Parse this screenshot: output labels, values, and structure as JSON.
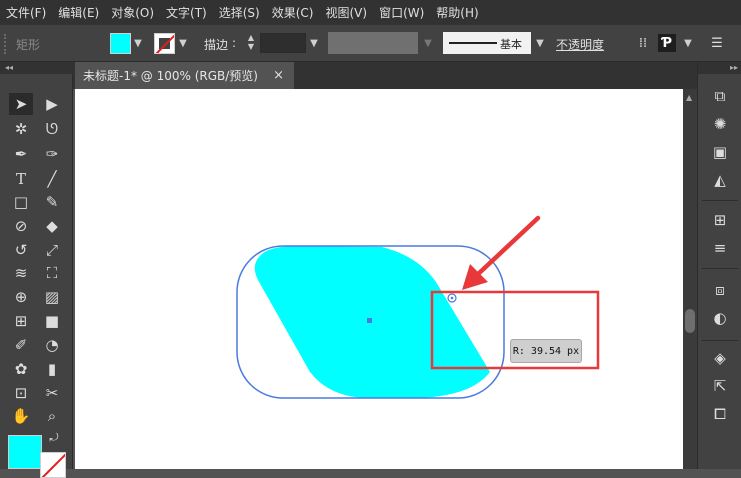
{
  "menu": [
    "文件(F)",
    "编辑(E)",
    "对象(O)",
    "文字(T)",
    "选择(S)",
    "效果(C)",
    "视图(V)",
    "窗口(W)",
    "帮助(H)"
  ],
  "control": {
    "tool_name": "矩形",
    "stroke_label": "描边",
    "stroke_colon": ":",
    "stroke_style": "基本",
    "opacity_label": "不透明度",
    "fill_color": "#00ffff",
    "stroke_color": "none"
  },
  "document": {
    "tab_title": "未标题-1* @ 100% (RGB/预览)",
    "close_glyph": "×"
  },
  "canvas": {
    "shape_fill": "#00ffff",
    "bounding_box_color": "#4a7ae0",
    "highlight_box_color": "#e8383a",
    "arrow_color": "#e8383a",
    "tooltip": "R: 39.54 px"
  },
  "left_tools": [
    "selection-tool",
    "direct-selection-tool",
    "magic-wand-tool",
    "lasso-tool",
    "pen-tool",
    "curvature-tool",
    "type-tool",
    "line-tool",
    "rectangle-tool",
    "paintbrush-tool",
    "shaper-tool",
    "eraser-tool",
    "rotate-tool",
    "scale-tool",
    "width-tool",
    "free-transform-tool",
    "shape-builder-tool",
    "perspective-grid-tool",
    "mesh-tool",
    "gradient-tool",
    "eyedropper-tool",
    "blend-tool",
    "symbol-sprayer-tool",
    "column-graph-tool",
    "artboard-tool",
    "slice-tool",
    "hand-tool",
    "zoom-tool"
  ],
  "right_panels": [
    "transform-icon",
    "color-icon",
    "swatches-icon",
    "libraries-icon",
    "align-icon",
    "stroke-icon",
    "pathfinder-icon",
    "transparency-icon",
    "layers-icon",
    "export-icon",
    "artboards-icon"
  ]
}
